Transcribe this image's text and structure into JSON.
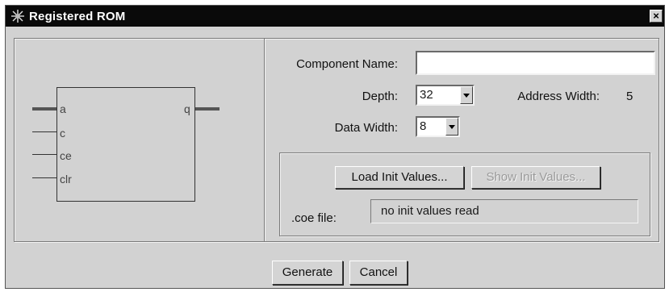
{
  "window": {
    "title": "Registered ROM",
    "close_glyph": "×"
  },
  "symbol": {
    "pins_in": [
      "a",
      "c",
      "ce",
      "clr"
    ],
    "pins_out": [
      "q"
    ]
  },
  "form": {
    "component_name": {
      "label": "Component Name:",
      "value": ""
    },
    "depth": {
      "label": "Depth:",
      "value": "32"
    },
    "address_width": {
      "label": "Address Width:",
      "value": "5"
    },
    "data_width": {
      "label": "Data Width:",
      "value": "8"
    }
  },
  "init": {
    "load_label": "Load Init Values...",
    "show_label": "Show Init Values...",
    "coe_label": ".coe file:",
    "coe_value": "no init values read"
  },
  "footer": {
    "generate_label": "Generate",
    "cancel_label": "Cancel"
  },
  "icons": {
    "app": "starburst-icon",
    "close": "close-icon",
    "dropdown": "chevron-down-icon"
  }
}
